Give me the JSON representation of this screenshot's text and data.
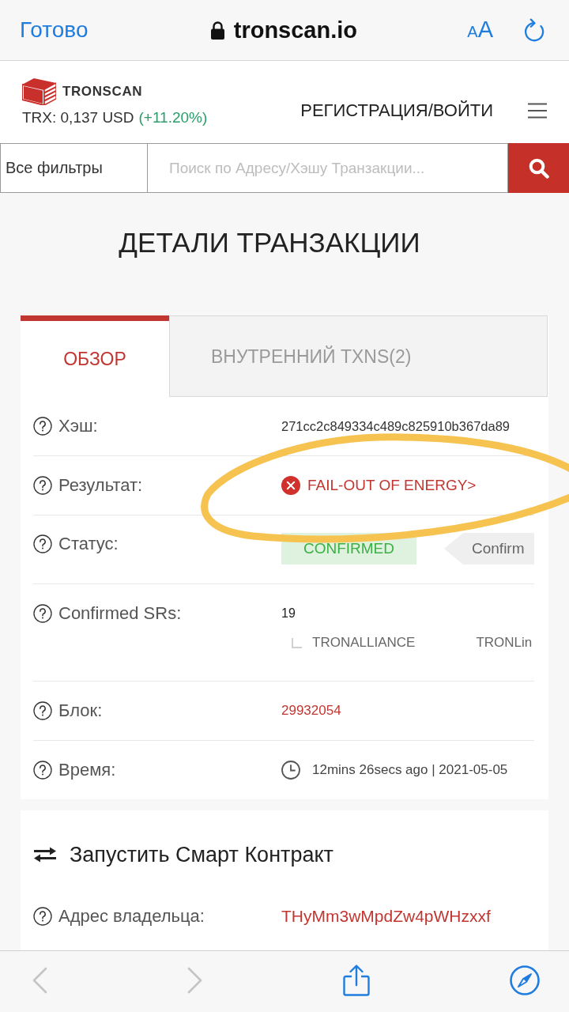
{
  "browser_bar": {
    "done": "Готово",
    "url": "tronscan.io",
    "text_size": "AA"
  },
  "header": {
    "logo_text": "TRONSCAN",
    "price": "TRX: 0,137 USD",
    "price_change": "(+11.20%)",
    "login": "РЕГИСТРАЦИЯ/ВОЙТИ"
  },
  "search": {
    "filter": "Все фильтры",
    "placeholder": "Поиск по Адресу/Хэшу Транзакции..."
  },
  "page_title": "ДЕТАЛИ ТРАНЗАКЦИИ",
  "tabs": [
    {
      "label": "ОБЗОР",
      "selected": true
    },
    {
      "label": "ВНУТРЕННИЙ TXNS(2)",
      "selected": false
    }
  ],
  "details": [
    {
      "kind": "text",
      "label": "Хэш:",
      "value": "271cc2c849334c489c825910b367da89"
    },
    {
      "kind": "result",
      "label": "Результат:",
      "value": "FAIL-OUT OF ENERGY>",
      "failed": true
    },
    {
      "kind": "status",
      "label": "Статус:",
      "badge": "CONFIRMED",
      "tag": "Confirm"
    },
    {
      "kind": "srs",
      "label": "Confirmed SRs:",
      "value": "19",
      "names": [
        "TRONALLIANCE",
        "TRONLin"
      ]
    },
    {
      "kind": "link",
      "label": "Блок:",
      "value": "29932054"
    },
    {
      "kind": "time",
      "label": "Время:",
      "value": "12mins 26secs ago | 2021-05-05"
    }
  ],
  "contract": {
    "title": "Запустить Смарт Контракт",
    "rows": [
      {
        "kind": "link",
        "label": "Адрес владельца:",
        "value": "THyMm3wMpdZw4pWHzxxf"
      }
    ]
  },
  "bottom_toolbar": {
    "back": {
      "disabled": true
    },
    "forward": {
      "disabled": true
    }
  }
}
